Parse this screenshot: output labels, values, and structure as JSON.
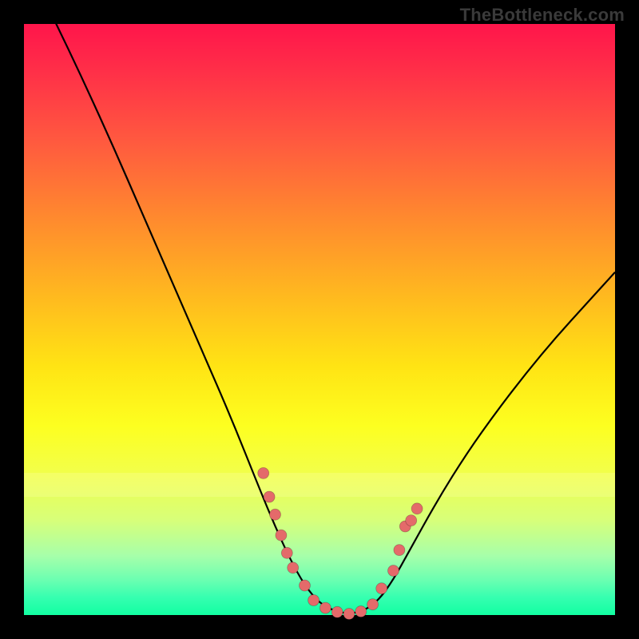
{
  "watermark": "TheBottleneck.com",
  "colors": {
    "background": "#000000",
    "gradient_top": "#ff154b",
    "gradient_bottom": "#12ffa2",
    "curve": "#000000",
    "marker": "#e46a6a"
  },
  "chart_data": {
    "type": "line",
    "title": "",
    "xlabel": "",
    "ylabel": "",
    "xlim": [
      0,
      100
    ],
    "ylim": [
      0,
      100
    ],
    "curve": {
      "name": "bottleneck-curve",
      "x": [
        0,
        5,
        10,
        15,
        20,
        25,
        30,
        35,
        40,
        42.5,
        45,
        47.5,
        50,
        52.5,
        55,
        57.5,
        60,
        62.5,
        65,
        70,
        75,
        80,
        85,
        90,
        95,
        100
      ],
      "y": [
        111,
        101,
        90.5,
        79.5,
        68.0,
        56.5,
        45.0,
        33.5,
        21.0,
        15.0,
        9.5,
        5.0,
        2.0,
        0.7,
        0.2,
        0.7,
        2.5,
        6.0,
        10.5,
        19.5,
        27.5,
        34.5,
        41.0,
        47.0,
        52.5,
        58.0
      ]
    },
    "markers": {
      "name": "highlighted-points",
      "x": [
        40.5,
        41.5,
        42.5,
        43.5,
        44.5,
        45.5,
        47.5,
        49.0,
        51.0,
        53.0,
        55.0,
        57.0,
        59.0,
        60.5,
        62.5,
        63.5,
        64.5,
        65.5,
        66.5
      ],
      "y": [
        24.0,
        20.0,
        17.0,
        13.5,
        10.5,
        8.0,
        5.0,
        2.5,
        1.2,
        0.5,
        0.2,
        0.6,
        1.8,
        4.5,
        7.5,
        11.0,
        15.0,
        16.0,
        18.0
      ]
    },
    "bright_band_y_range": [
      20,
      24
    ]
  }
}
